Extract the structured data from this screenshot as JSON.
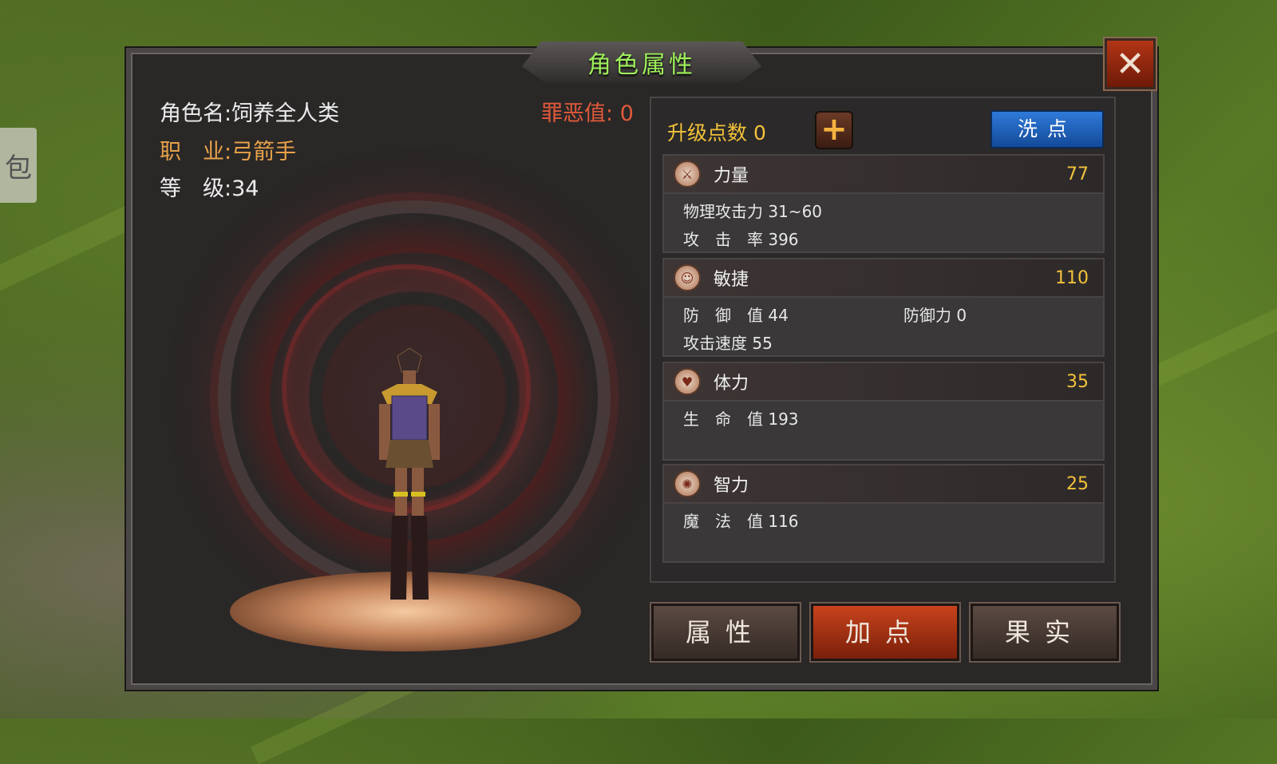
{
  "side_tab": {
    "label": "包"
  },
  "window": {
    "title": "角色属性",
    "close_label": "✕"
  },
  "character": {
    "name_label": "角色名:",
    "name_value": "饲养全人类",
    "job_label": "职　业:",
    "job_value": "弓箭手",
    "level_label": "等　级:",
    "level_value": "34",
    "evil_label": "罪恶值:",
    "evil_value": "0"
  },
  "points": {
    "label": "升级点数",
    "value": "0",
    "plus_label": "+",
    "reset_label": "洗点"
  },
  "stats": [
    {
      "name": "力量",
      "value": "77",
      "icon": "sword-icon",
      "subs": [
        {
          "label": "物理攻击力",
          "value": "31~60"
        },
        {
          "label": "攻　击　率",
          "value": "396"
        }
      ]
    },
    {
      "name": "敏捷",
      "value": "110",
      "icon": "agility-icon",
      "subs": [
        {
          "label": "防　御　值",
          "value": "44"
        },
        {
          "label": "防御力",
          "value": "0"
        },
        {
          "label": "攻击速度",
          "value": "55"
        }
      ]
    },
    {
      "name": "体力",
      "value": "35",
      "icon": "heart-icon",
      "subs": [
        {
          "label": "生　命　值",
          "value": "193"
        }
      ]
    },
    {
      "name": "智力",
      "value": "25",
      "icon": "spiral-icon",
      "subs": [
        {
          "label": "魔　法　值",
          "value": "116"
        }
      ]
    }
  ],
  "tabs": [
    {
      "label": "属性"
    },
    {
      "label": "加点"
    },
    {
      "label": "果实"
    }
  ],
  "colors": {
    "title_green": "#9ef05a",
    "gold": "#f2c23a",
    "orange": "#e8a24a",
    "evil_red": "#e05a3a",
    "active_tab": "#c8431c",
    "reset_blue": "#2f7ad8"
  }
}
